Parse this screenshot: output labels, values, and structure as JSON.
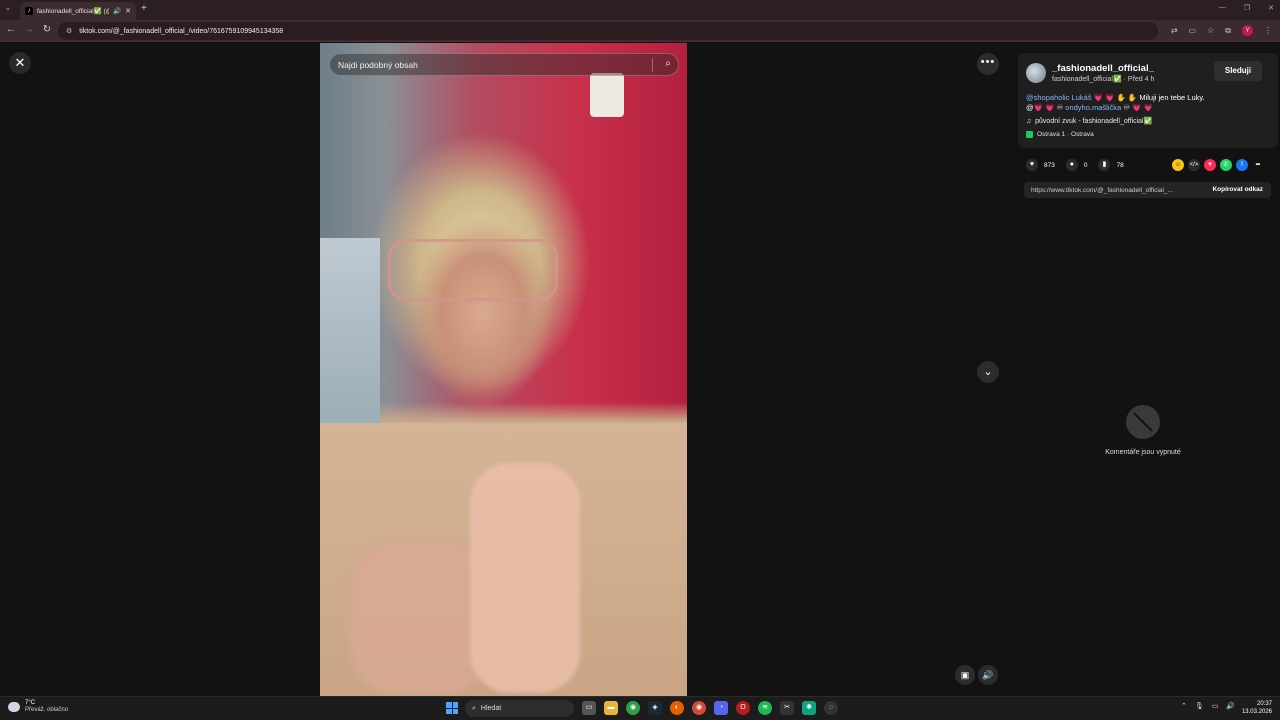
{
  "browser": {
    "tab_title": "fashionadell_official✅ (@",
    "url": "tiktok.com/@_fashionadell_official_/video/7616759109945134358",
    "profile_initial": "Y"
  },
  "video": {
    "search_placeholder": "Najdi podobný obsah"
  },
  "post": {
    "username": "_fashionadell_official_",
    "handle": "fashionadell_official✅",
    "time": "· Před 4 h",
    "follow_label": "Sleduji",
    "desc_mention1": "@shopaholic Lukáš",
    "desc_rest1": " 💗 💗 ✋ ✋ Miluji jen tebe Luky.",
    "desc_line2_prefix": "@💗 💗 ♾",
    "desc_mention2": "ondyho.mašlička",
    "desc_line2_suffix": " ♾ 💗 💗",
    "music": "původní zvuk - fashionadell_official✅",
    "location": "Ostrava 1 · Ostrava",
    "likes": "873",
    "comments": "0",
    "saves": "78",
    "link": "https://www.tiktok.com/@_fashionadell_official_...",
    "copy_label": "Kopírovat odkaz",
    "comments_off": "Komentáře jsou vypnuté"
  },
  "taskbar": {
    "temp": "7°C",
    "condition": "Převáž. oblačno",
    "search_label": "Hledat",
    "time": "20:37",
    "date": "13.03.2026"
  },
  "colors": {
    "accent_mention": "#8ab4f8",
    "browser_frame": "#3b2a2e",
    "background": "#121212"
  }
}
